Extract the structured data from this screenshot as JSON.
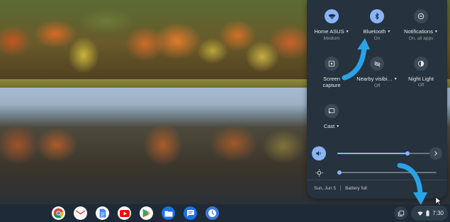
{
  "quick_settings": {
    "tiles": [
      {
        "label": "Home ASUS",
        "sub": "Medium",
        "icon": "wifi-icon",
        "active": true,
        "dropdown": true
      },
      {
        "label": "Bluetooth",
        "sub": "On",
        "icon": "bluetooth-icon",
        "active": true,
        "dropdown": true
      },
      {
        "label": "Notifications",
        "sub": "On, all apps",
        "icon": "do-not-disturb-icon",
        "active": false,
        "dropdown": true
      },
      {
        "label": "Screen",
        "label2": "capture",
        "sub": "",
        "icon": "screen-capture-icon",
        "active": false,
        "dropdown": false
      },
      {
        "label": "Nearby visibi…",
        "sub": "Off",
        "icon": "nearby-share-off-icon",
        "active": false,
        "dropdown": true
      },
      {
        "label": "Night Light",
        "sub": "Off",
        "icon": "night-light-icon",
        "active": false,
        "dropdown": false
      },
      {
        "label": "Cast",
        "sub": "",
        "icon": "cast-icon",
        "active": false,
        "dropdown": true
      }
    ],
    "volume": {
      "level": 0.76,
      "icon": "volume-icon"
    },
    "brightness": {
      "level": 0.02,
      "icon": "brightness-icon"
    },
    "footer": {
      "date": "Sun, Jun 5",
      "battery": "Battery full"
    }
  },
  "shelf": {
    "apps": [
      "chrome-icon",
      "gmail-icon",
      "docs-icon",
      "youtube-icon",
      "play-store-icon",
      "files-icon",
      "messages-icon",
      "clock-icon"
    ],
    "tray": {
      "time": "7:30"
    }
  },
  "colors": {
    "accent": "#8ab4f8",
    "panel": "#26323d",
    "shelf": "#1e2a37",
    "arrow": "#29a3e8"
  }
}
